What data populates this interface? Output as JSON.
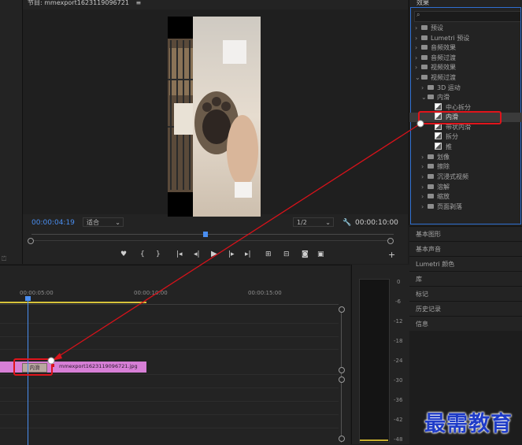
{
  "program_monitor": {
    "title": "节目: mmexport1623119096721",
    "menu_icon": "≡",
    "current_time": "00:00:04:19",
    "fit": "适合",
    "resolution": "1/2",
    "duration": "00:00:10:00",
    "playhead_fraction": 0.48
  },
  "effects_panel": {
    "title": "效果",
    "search_placeholder": "",
    "tree": [
      {
        "label": "预设",
        "kind": "folder"
      },
      {
        "label": "Lumetri 预设",
        "kind": "folder"
      },
      {
        "label": "音频效果",
        "kind": "folder"
      },
      {
        "label": "音频过渡",
        "kind": "folder"
      },
      {
        "label": "视频效果",
        "kind": "folder"
      },
      {
        "label": "视频过渡",
        "kind": "folder-open"
      },
      {
        "label": "3D 运动",
        "kind": "folder"
      },
      {
        "label": "内滑",
        "kind": "folder-open"
      },
      {
        "label": "中心拆分",
        "kind": "transition"
      },
      {
        "label": "内滑",
        "kind": "transition",
        "selected": true
      },
      {
        "label": "带状内滑",
        "kind": "transition"
      },
      {
        "label": "拆分",
        "kind": "transition"
      },
      {
        "label": "推",
        "kind": "transition"
      },
      {
        "label": "划像",
        "kind": "folder"
      },
      {
        "label": "擦除",
        "kind": "folder"
      },
      {
        "label": "沉浸式视频",
        "kind": "folder"
      },
      {
        "label": "溶解",
        "kind": "folder"
      },
      {
        "label": "缩放",
        "kind": "folder"
      },
      {
        "label": "页面剥落",
        "kind": "folder"
      }
    ]
  },
  "side_panels": [
    "基本图形",
    "基本声音",
    "Lumetri 颜色",
    "库",
    "标记",
    "历史记录",
    "信息"
  ],
  "timeline": {
    "ruler": [
      "00:00:05:00",
      "00:00:10:00",
      "00:00:15:00"
    ],
    "clip_name": "mmexport1623119096721.jpg",
    "transition_label": "内滑"
  },
  "audio_meter": {
    "scale": [
      "0",
      "-6",
      "-12",
      "-18",
      "-24",
      "-30",
      "-36",
      "-42",
      "-48"
    ]
  },
  "watermark": "最需教育",
  "colors": {
    "accent": "#2f6fd1",
    "clip": "#d77fd6",
    "highlight_box": "#e0141b",
    "arrow": "#d8121a"
  }
}
